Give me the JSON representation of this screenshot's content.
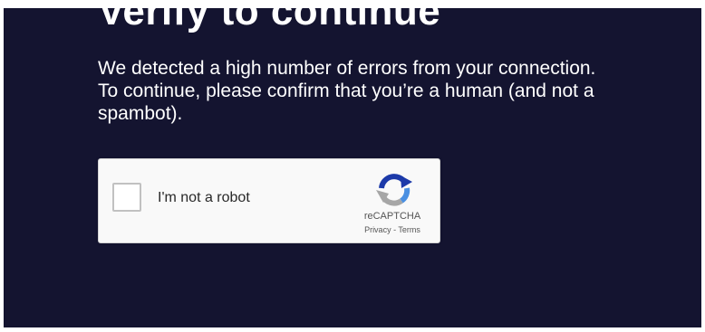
{
  "heading": "Verify to continue",
  "message": "We detected a high number of errors from your connection. To continue, please confirm that you’re a human (and not a spambot).",
  "recaptcha": {
    "checkbox_label": "I'm not a robot",
    "brand": "reCAPTCHA",
    "privacy_link": "Privacy",
    "separator": " - ",
    "terms_link": "Terms",
    "logo_icon": "recaptcha-logo-icon"
  },
  "colors": {
    "background": "#141430",
    "text": "#ffffff",
    "widget_background": "#f9f9f9",
    "logo_blue": "#1c3aa9",
    "logo_light_blue": "#4a90e2",
    "logo_gray": "#a6a6a6"
  }
}
